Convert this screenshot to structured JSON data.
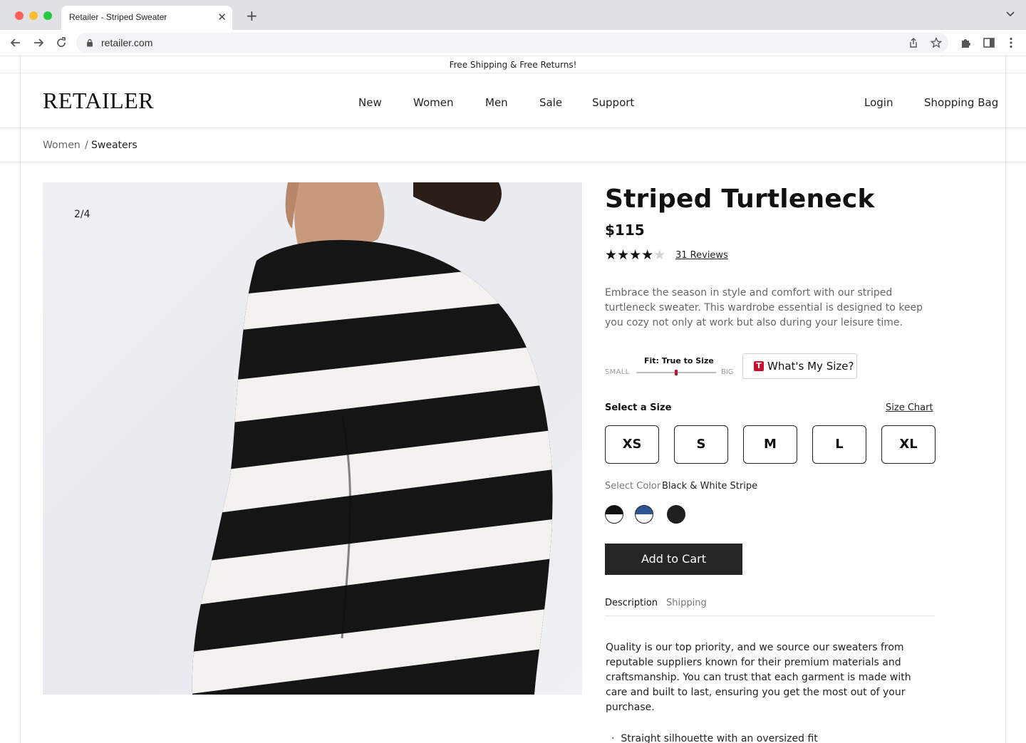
{
  "browser": {
    "tab_title": "Retailer - Striped Sweater",
    "tab_close": "✕",
    "new_tab": "+",
    "url": "retailer.com"
  },
  "promo": "Free Shipping & Free Returns!",
  "header": {
    "logo": "RETAILER",
    "nav": [
      "New",
      "Women",
      "Men",
      "Sale",
      "Support"
    ],
    "login": "Login",
    "bag": "Shopping Bag"
  },
  "breadcrumb": {
    "parent": "Women",
    "separator": "/",
    "current": "Sweaters"
  },
  "gallery": {
    "counter": "2/4"
  },
  "product": {
    "title": "Striped Turtleneck",
    "price": "$115",
    "rating": 4,
    "rating_max": 5,
    "reviews": "31 Reviews",
    "description": "Embrace the season in style and comfort with our striped turtleneck sweater. This wardrobe essential is designed to keep you cozy not only at work but also during your leisure time."
  },
  "fit": {
    "label": "Fit: True to Size",
    "small": "SMALL",
    "big": "BIG",
    "level": 0.5,
    "help_button": "What's My Size?",
    "help_logo": "T",
    "accent": "#c8102e"
  },
  "sizes": {
    "label": "Select a Size",
    "chart_link": "Size Chart",
    "options": [
      "XS",
      "S",
      "M",
      "L",
      "XL"
    ]
  },
  "color": {
    "label": "Select Color",
    "selected": "Black & White Stripe",
    "swatches": [
      {
        "name": "black-white-stripe",
        "top": "#111111",
        "bottom": "#ffffff"
      },
      {
        "name": "blue-white-stripe",
        "top": "#2f5597",
        "bottom": "#ffffff"
      },
      {
        "name": "black",
        "top": "#1f1f1f",
        "bottom": "#1f1f1f"
      }
    ]
  },
  "cart": {
    "add_label": "Add to Cart",
    "button_color": "#262626"
  },
  "tabs": {
    "description": "Description",
    "shipping": "Shipping"
  },
  "details": {
    "text": "Quality is our top priority, and we source our sweaters from reputable suppliers known for their premium materials and craftsmanship. You can trust that each garment is made with care and built to last, ensuring you get the most out of your purchase.",
    "bullet": "Straight silhouette with an oversized fit"
  }
}
